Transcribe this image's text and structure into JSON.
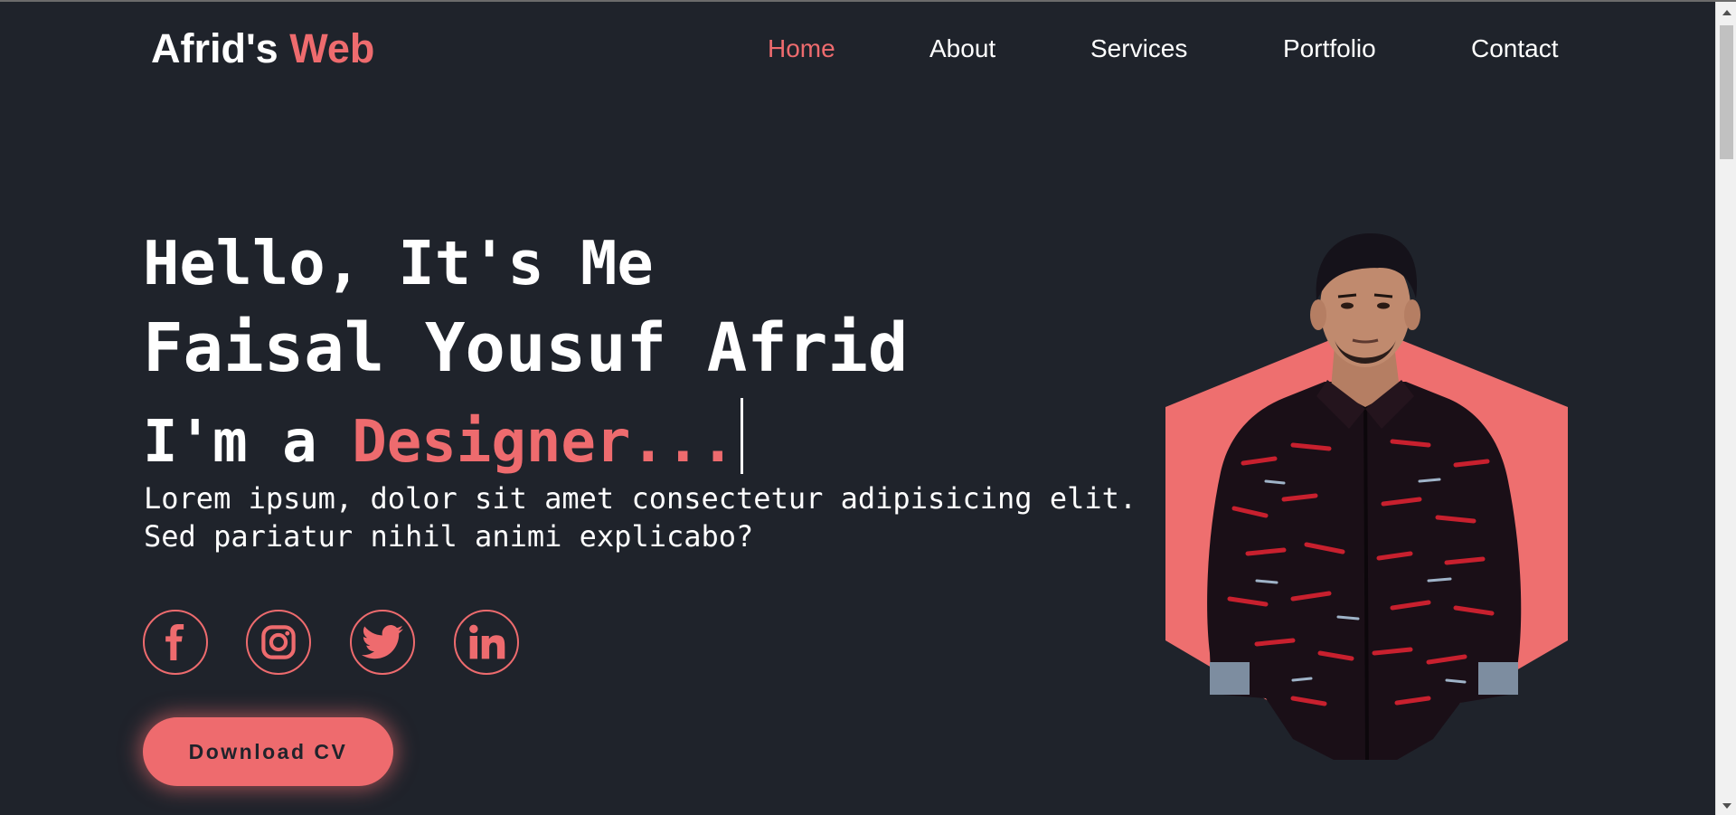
{
  "header": {
    "logo_main": "Afrid's",
    "logo_accent": "Web",
    "nav": [
      "Home",
      "About",
      "Services",
      "Portfolio",
      "Contact"
    ],
    "active_nav": "Home"
  },
  "hero": {
    "greeting": "Hello, It's Me",
    "name": "Faisal Yousuf Afrid",
    "role_prefix": "I'm a",
    "role_word": "Designer...",
    "description_line1": "Lorem ipsum, dolor sit amet consectetur adipisicing elit.",
    "description_line2": "Sed pariatur nihil animi explicabo?",
    "socials": [
      "facebook-icon",
      "instagram-icon",
      "twitter-icon",
      "linkedin-icon"
    ],
    "cta_label": "Download CV"
  },
  "colors": {
    "background": "#1f232b",
    "accent": "#ee6b6e",
    "text": "#ffffff"
  }
}
